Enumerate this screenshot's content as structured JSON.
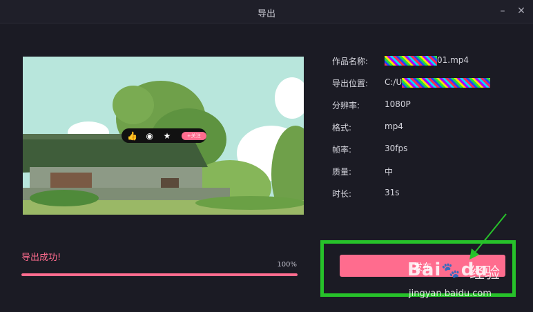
{
  "window": {
    "title": "导出",
    "minimize_icon": "minimize-icon",
    "close_icon": "close-icon"
  },
  "preview": {
    "overlay": {
      "icons": [
        "thumbs-up-icon",
        "coin-icon",
        "star-icon"
      ],
      "pill_label": "+关注"
    }
  },
  "info": {
    "rows": [
      {
        "label": "作品名称:",
        "value": "01.mp4"
      },
      {
        "label": "导出位置:",
        "value": "C:/U"
      },
      {
        "label": "分辨率:",
        "value": "1080P"
      },
      {
        "label": "格式:",
        "value": "mp4"
      },
      {
        "label": "帧率:",
        "value": "30fps"
      },
      {
        "label": "质量:",
        "value": "中"
      },
      {
        "label": "时长:",
        "value": "31s"
      }
    ]
  },
  "status": {
    "text": "导出成功!",
    "percent_label": "100%",
    "progress": 1.0
  },
  "publish": {
    "label": "发布"
  },
  "colors": {
    "accent": "#ff6c8e",
    "highlight": "#27c22a",
    "background": "#1b1b24"
  },
  "watermark": {
    "logo": "Bai",
    "logo2": "du",
    "jingyan": "经验",
    "url": "jingyan.baidu.com"
  }
}
